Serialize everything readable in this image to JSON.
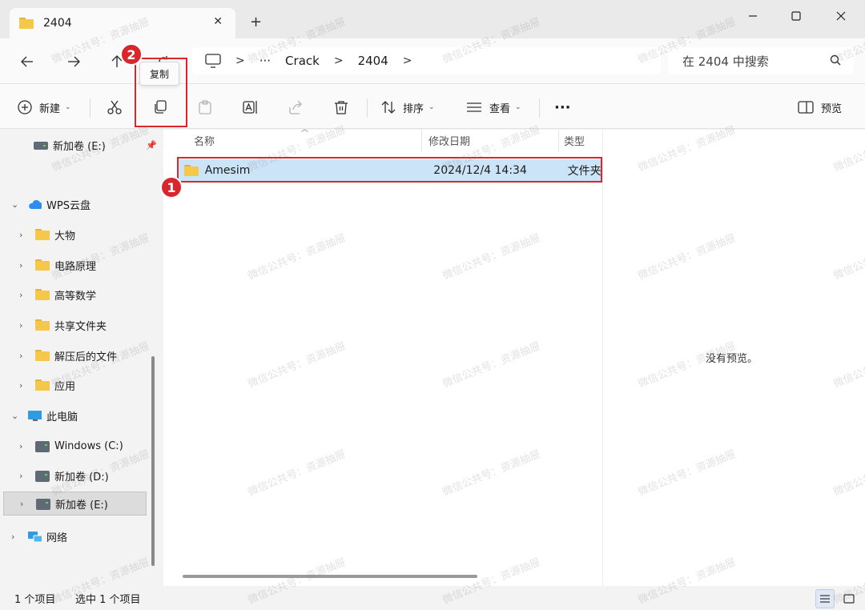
{
  "window": {
    "tab_title": "2404",
    "tab_close": "✕",
    "new_tab": "+",
    "minimize": "minimize",
    "maximize": "maximize",
    "close": "close"
  },
  "address": {
    "ellipsis": "···",
    "crumbs": [
      "Crack",
      "2404"
    ],
    "search_placeholder": "在 2404 中搜索"
  },
  "toolbar": {
    "new_label": "新建",
    "sort_label": "排序",
    "view_label": "查看",
    "more_label": "···",
    "preview_label": "预览",
    "copy_tooltip": "复制"
  },
  "annotations": {
    "badge1": "1",
    "badge2": "2",
    "accent": "#d9262c"
  },
  "sidebar": {
    "pinned_drive": "新加卷 (E:)",
    "cloud": "WPS云盘",
    "cloud_items": [
      "大物",
      "电路原理",
      "高等数学",
      "共享文件夹",
      "解压后的文件",
      "应用"
    ],
    "this_pc": "此电脑",
    "pc_items": [
      "Windows (C:)",
      "新加卷 (D:)",
      "新加卷 (E:)"
    ],
    "network": "网络"
  },
  "filelist": {
    "columns": [
      "名称",
      "修改日期",
      "类型"
    ],
    "rows": [
      {
        "name": "Amesim",
        "modified": "2024/12/4 14:34",
        "type": "文件夹"
      }
    ]
  },
  "preview": {
    "empty_text": "没有预览。"
  },
  "status": {
    "count": "1 个项目",
    "selected": "选中 1 个项目"
  },
  "watermark": "微信公共号：资源抽屉"
}
